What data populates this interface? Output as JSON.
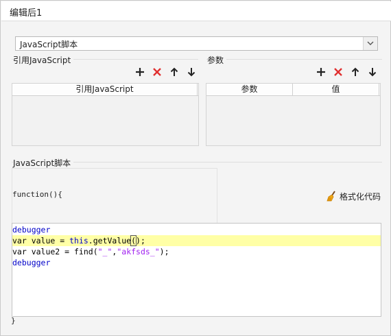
{
  "window": {
    "title": "编辑后1"
  },
  "script_type": {
    "selected": "JavaScript脚本"
  },
  "ref_section": {
    "label": "引用JavaScript",
    "columns": [
      "引用JavaScript"
    ]
  },
  "param_section": {
    "label": "参数",
    "columns": [
      "参数",
      "值"
    ]
  },
  "script_section": {
    "label": "JavaScript脚本"
  },
  "editor": {
    "function_header": "function(){",
    "format_button": "格式化代码",
    "closing": "}",
    "lines": [
      [
        {
          "t": "debugger",
          "c": "kw"
        }
      ],
      [
        {
          "t": "var value = ",
          "c": "plain"
        },
        {
          "t": "this",
          "c": "kw"
        },
        {
          "t": ".getValue",
          "c": "plain"
        },
        {
          "t": "(",
          "c": "plain caret"
        },
        {
          "t": ");",
          "c": "plain"
        }
      ],
      [
        {
          "t": "var value2 = find(",
          "c": "plain"
        },
        {
          "t": "\"_\"",
          "c": "str"
        },
        {
          "t": ",",
          "c": "plain"
        },
        {
          "t": "\"akfsds_\"",
          "c": "str"
        },
        {
          "t": ");",
          "c": "plain"
        }
      ],
      [
        {
          "t": "debugger",
          "c": "kw"
        }
      ]
    ],
    "highlighted_line": 2
  },
  "icons": {
    "add": "plus-icon",
    "delete": "red-x-icon",
    "up": "arrow-up-icon",
    "down": "arrow-down-icon",
    "dropdown": "chevron-down-icon",
    "format": "broom-icon"
  },
  "colors": {
    "delete": "#e03030",
    "keyword": "#0000c8",
    "string": "#a020f0",
    "highlight": "#ffffa6"
  }
}
